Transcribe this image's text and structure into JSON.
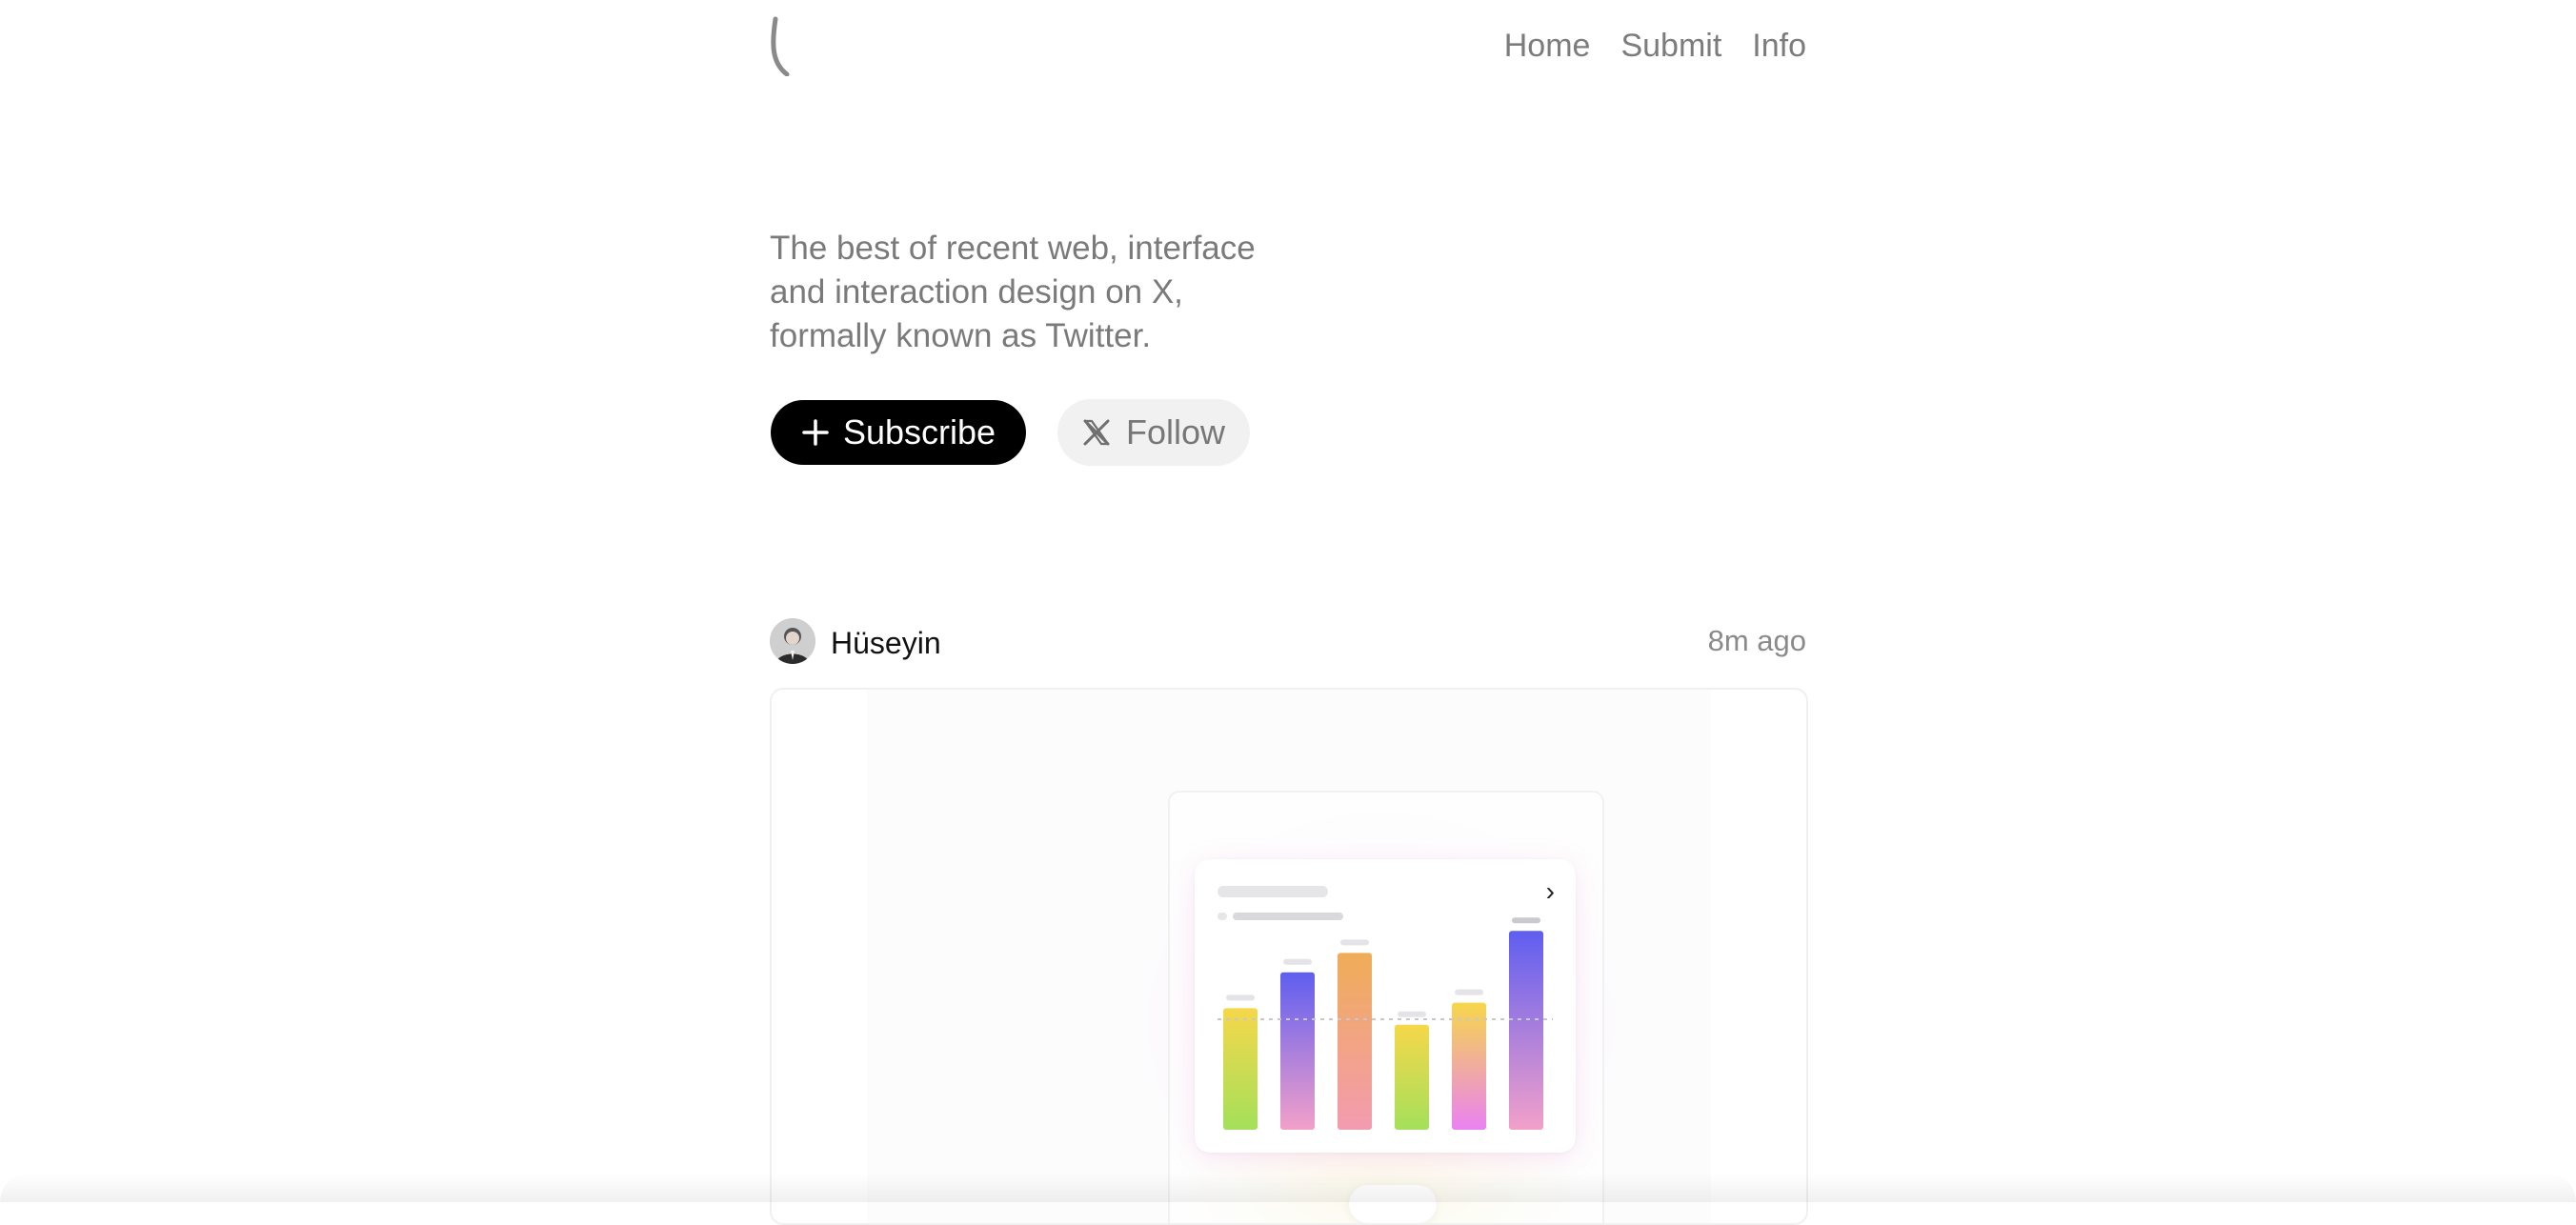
{
  "nav": {
    "items": [
      {
        "label": "Home"
      },
      {
        "label": "Submit"
      },
      {
        "label": "Info"
      }
    ]
  },
  "hero": {
    "tagline": "The best of recent web, interface and interaction design on X, formally known as Twitter.",
    "subscribe_label": "Subscribe",
    "follow_label": "Follow"
  },
  "post": {
    "author": "Hüseyin",
    "time": "8m ago",
    "media": {
      "chart_data": {
        "type": "bar",
        "values": [
          0.44,
          0.57,
          0.64,
          0.38,
          0.46,
          0.72
        ],
        "series_colors": [
          [
            "#f6d74a",
            "#a4e05a"
          ],
          [
            "#5f5ef0",
            "#f3a0c9"
          ],
          [
            "#f0ad57",
            "#f39bb0"
          ],
          [
            "#f6d74a",
            "#a4e05a"
          ],
          [
            "#f6d74a",
            "#ea82f2"
          ],
          [
            "#5f5ef0",
            "#f3a0c9"
          ]
        ],
        "reference_line": 0.4
      }
    }
  },
  "icons": {
    "logo": "logo-mark-icon",
    "subscribe": "plus-icon",
    "follow": "x-logo-icon",
    "card_more": "chevron-right-icon"
  },
  "colors": {
    "primary": "#000000",
    "text_muted": "#7a7a7a",
    "follow_bg": "#f1f1f1"
  }
}
